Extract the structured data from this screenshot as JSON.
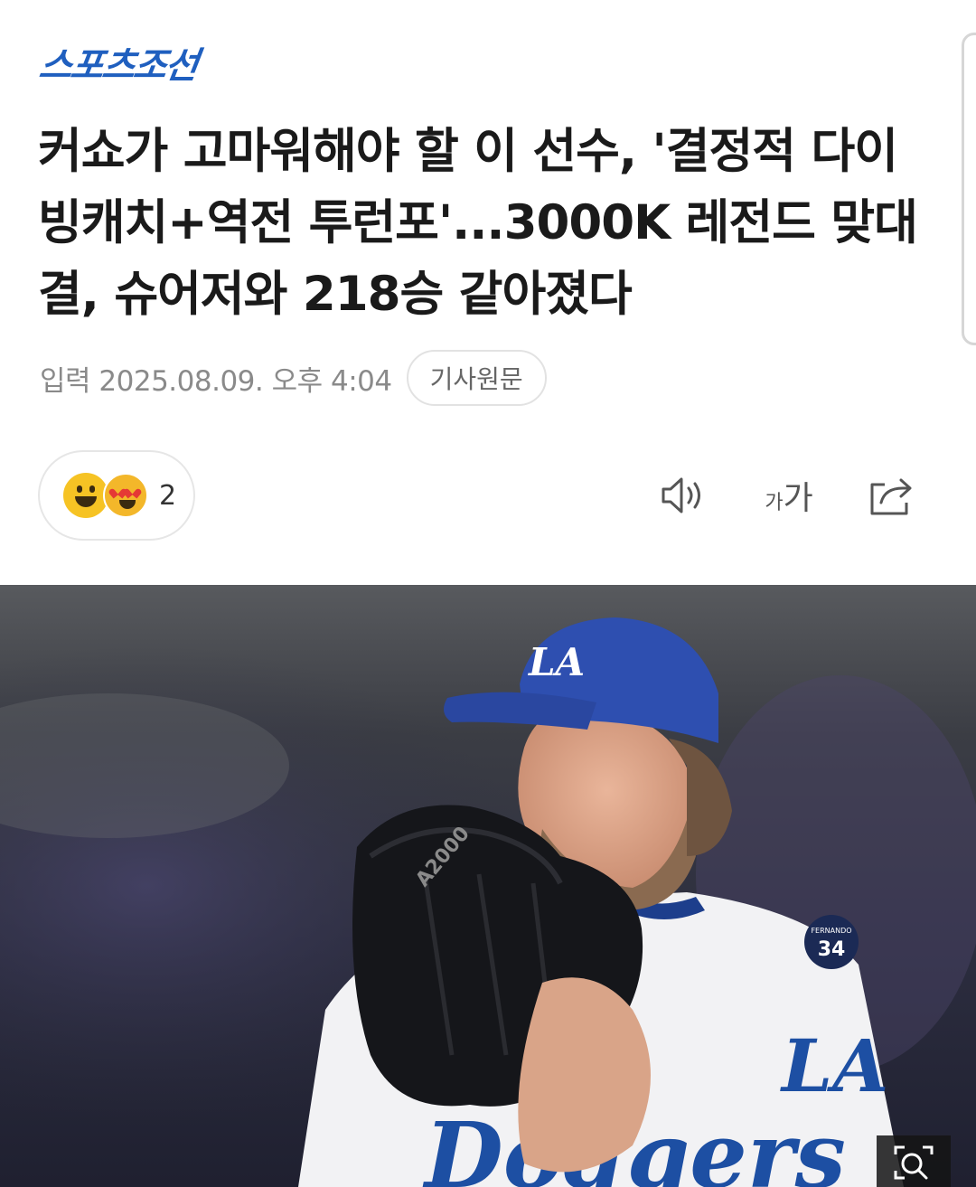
{
  "header": {
    "logo_text": "스포츠조선",
    "brand_color": "#1f5fbf"
  },
  "article": {
    "title": "커쇼가 고마워해야 할 이 선수, '결정적 다이빙캐치+역전 투런포'...3000K 레전드 맞대결, 슈어저와 218승 같아졌다",
    "date_text": "입력 2025.08.09. 오후 4:04",
    "original_button": "기사원문"
  },
  "reactions": {
    "count": "2",
    "emojis": [
      "smile-emoji",
      "heart-eyes-emoji"
    ]
  },
  "toolbar": {
    "speaker_icon": "speaker-icon",
    "font_small": "가",
    "font_big": "가",
    "share_icon": "share-icon"
  },
  "photo": {
    "cap_letters": "LA",
    "glove_text": "A2000",
    "patch_top": "FERNANDO",
    "patch_number": "34",
    "sleeve_letters": "LA",
    "jersey_text": "Dodgers",
    "zoom_icon": "zoom-icon"
  }
}
